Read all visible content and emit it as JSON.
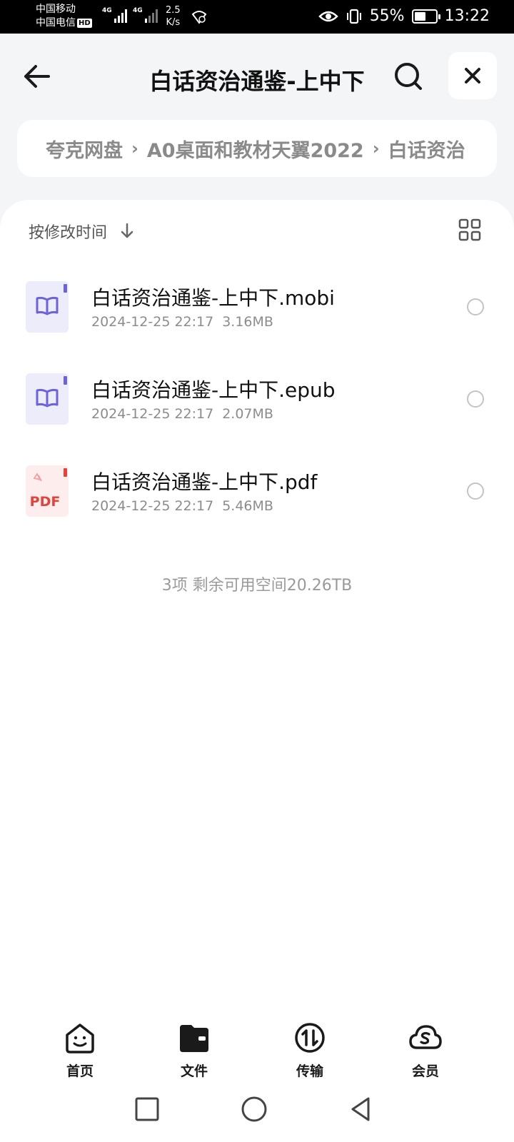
{
  "status_bar": {
    "carrier1": "中国移动",
    "carrier2": "中国电信",
    "hd": "HD",
    "net1": "4G",
    "net2": "4G",
    "speed_value": "2.5",
    "speed_unit": "K/s",
    "battery_percent": "55%",
    "battery_level": 0.55,
    "time": "13:22"
  },
  "header": {
    "title": "白话资治通鉴-上中下"
  },
  "breadcrumb": {
    "items": [
      "夸克网盘",
      "A0桌面和教材天翼2022",
      "白话资治"
    ]
  },
  "sort": {
    "label": "按修改时间"
  },
  "files": [
    {
      "name": "白话资治通鉴-上中下.mobi",
      "date": "2024-12-25 22:17",
      "size": "3.16MB",
      "type": "book-icon"
    },
    {
      "name": "白话资治通鉴-上中下.epub",
      "date": "2024-12-25 22:17",
      "size": "2.07MB",
      "type": "book-icon"
    },
    {
      "name": "白话资治通鉴-上中下.pdf",
      "date": "2024-12-25 22:17",
      "size": "5.46MB",
      "type": "pdf-icon",
      "badge": "PDF"
    }
  ],
  "summary": "3项 剩余可用空间20.26TB",
  "bottom_nav": {
    "items": [
      {
        "label": "首页",
        "icon": "home-smile-icon"
      },
      {
        "label": "文件",
        "icon": "folder-icon",
        "active": true
      },
      {
        "label": "传输",
        "icon": "transfer-icon"
      },
      {
        "label": "会员",
        "icon": "cloud-vip-icon"
      }
    ]
  },
  "colors": {
    "book_icon_bg": "#ececfb",
    "book_icon_fg": "#6b63d6",
    "pdf_icon_bg": "#fdeded",
    "pdf_icon_fg": "#e0443d"
  }
}
